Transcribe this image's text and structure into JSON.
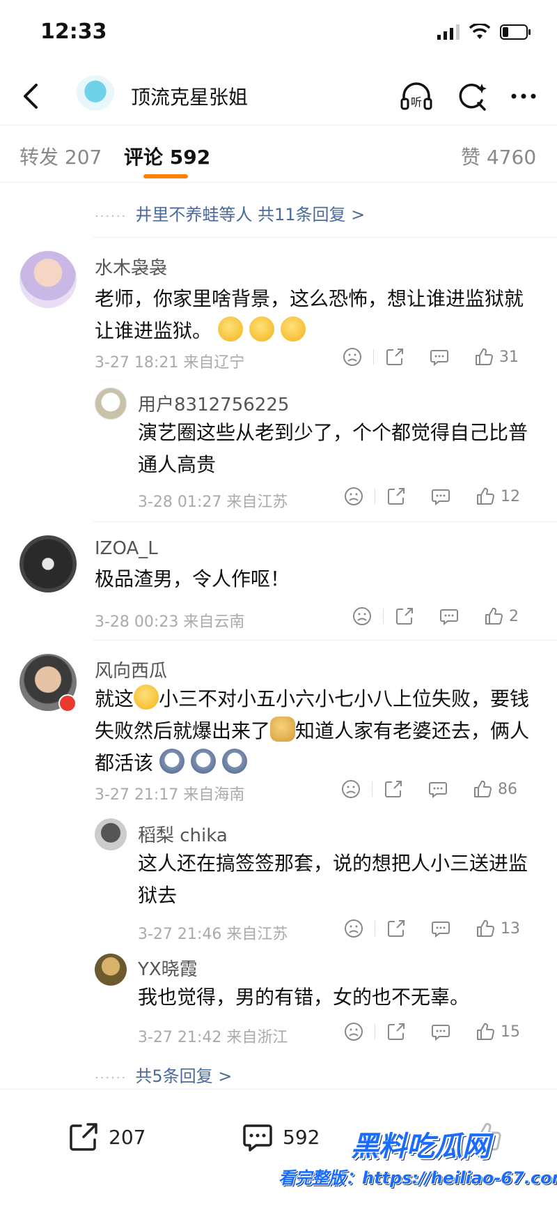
{
  "status_bar": {
    "time": "12:33"
  },
  "nav": {
    "title": "顶流克星张姐",
    "icons": [
      "back-icon",
      "listen-icon",
      "search-icon",
      "more-icon"
    ],
    "listen_label": "听"
  },
  "tabs": {
    "repost_label": "转发",
    "repost_count": "207",
    "comment_label": "评论",
    "comment_count": "592",
    "like_label": "赞",
    "like_count": "4760"
  },
  "top_replies_link": "井里不养蛙等人 共11条回复 >",
  "comments": [
    {
      "name": "水木袅袅",
      "text": "老师，你家里啥背景，这么恐怖，想让谁进监狱就让谁进监狱。",
      "time": "3-27 18:21 来自辽宁",
      "likes": "31",
      "emoji_count": 3
    },
    {
      "name": "用户8312756225",
      "text": "演艺圈这些从老到少了，个个都觉得自己比普通人高贵",
      "time": "3-28 01:27 来自江苏",
      "likes": "12"
    },
    {
      "name": "IZOA_L",
      "text": "极品渣男，令人作呕！",
      "time": "3-28 00:23 来自云南",
      "likes": "2"
    },
    {
      "name": "风向西瓜",
      "text_part1": "就这",
      "text_part2": "小三不对小五小六小七小八上位失败，要钱失败然后就爆出来了",
      "text_part3": "知道人家有老婆还去，俩人都活该",
      "time": "3-27 21:17 来自海南",
      "likes": "86"
    },
    {
      "name": "稻梨 chika",
      "text": "这人还在搞签签那套，说的想把人小三送进监狱去",
      "time": "3-27 21:46 来自江苏",
      "likes": "13"
    },
    {
      "name": "YX晓霞",
      "text": "我也觉得，男的有错，女的也不无辜。",
      "time": "3-27 21:42 来自浙江",
      "likes": "15"
    }
  ],
  "bottom_replies_link": "共5条回复 >",
  "bottom_bar": {
    "repost_count": "207",
    "comment_count": "592"
  },
  "watermark": {
    "line1": "黑料吃瓜网",
    "line2": "看完整版：https://heiliao-67.com"
  },
  "colors": {
    "accent": "#ff8200",
    "link": "#4a6a9a"
  }
}
